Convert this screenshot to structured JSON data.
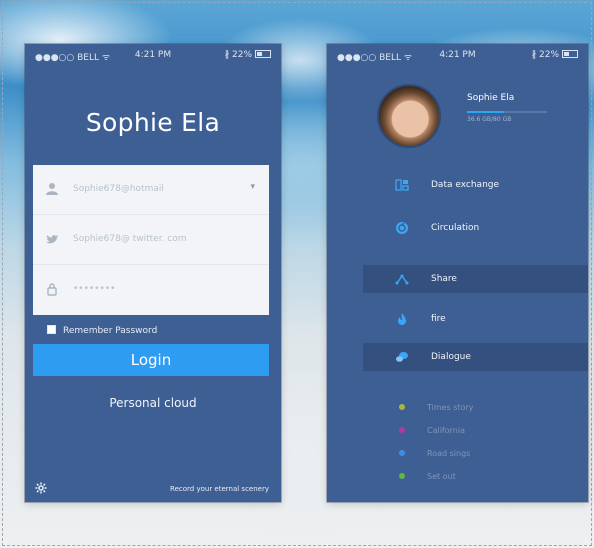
{
  "status_bar": {
    "carrier": "●●●○○ BELL ᯤ",
    "time": "4:21 PM",
    "battery": "∦ 22%"
  },
  "login": {
    "title": "Sophie Ela",
    "email_value": "Sophie678@hotmail",
    "twitter_value": "Sophie678@ twitter. com",
    "password_value": "••••••••",
    "remember_label": "Remember Password",
    "login_label": "Login",
    "personal_cloud": "Personal cloud",
    "footer_text": "Record your eternal scenery"
  },
  "profile": {
    "name": "Sophie Ela",
    "storage_text": "36.6 GB/80 GB",
    "storage_fraction": 0.46
  },
  "menu": [
    {
      "label": "Data exchange",
      "icon": "data-exchange-icon",
      "active": false
    },
    {
      "label": "Circulation",
      "icon": "circulation-icon",
      "active": false
    },
    {
      "label": "Share",
      "icon": "share-icon",
      "active": true
    },
    {
      "label": "fire",
      "icon": "fire-icon",
      "active": false
    },
    {
      "label": "Dialogue",
      "icon": "dialogue-icon",
      "active": true
    }
  ],
  "sub_items": [
    {
      "label": "Times story",
      "color": "#a7b83a"
    },
    {
      "label": "California",
      "color": "#b13c9c"
    },
    {
      "label": "Road sings",
      "color": "#3e8ee0"
    },
    {
      "label": "Set out",
      "color": "#5cb84a"
    }
  ],
  "colors": {
    "accent": "#2e9cf0",
    "panel": "#3e5f93",
    "highlight_row": "#33507e"
  }
}
